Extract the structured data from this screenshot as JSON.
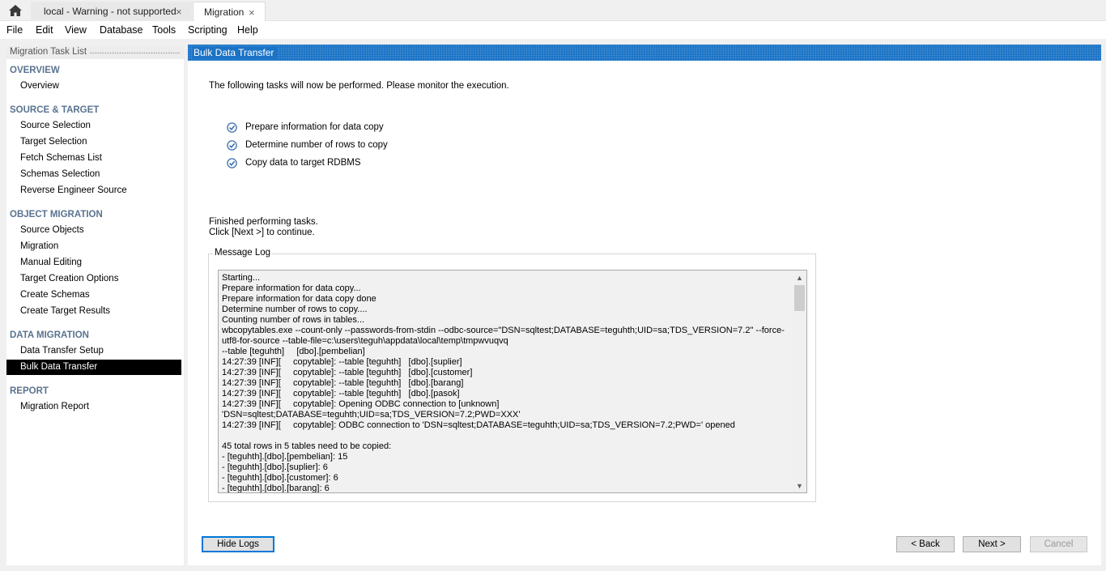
{
  "tabs": [
    {
      "label": "local - Warning - not supported",
      "close": "×"
    },
    {
      "label": "Migration",
      "close": "×"
    }
  ],
  "menu": [
    "File",
    "Edit",
    "View",
    "Database",
    "Tools",
    "Scripting",
    "Help"
  ],
  "sidebar": {
    "title": "Migration Task List",
    "sections": [
      {
        "title": "OVERVIEW",
        "items": [
          "Overview"
        ]
      },
      {
        "title": "SOURCE & TARGET",
        "items": [
          "Source Selection",
          "Target Selection",
          "Fetch Schemas List",
          "Schemas Selection",
          "Reverse Engineer Source"
        ]
      },
      {
        "title": "OBJECT MIGRATION",
        "items": [
          "Source Objects",
          "Migration",
          "Manual Editing",
          "Target Creation Options",
          "Create Schemas",
          "Create Target Results"
        ]
      },
      {
        "title": "DATA MIGRATION",
        "items": [
          "Data Transfer Setup",
          "Bulk Data Transfer"
        ]
      },
      {
        "title": "REPORT",
        "items": [
          "Migration Report"
        ]
      }
    ],
    "selected": "Bulk Data Transfer"
  },
  "main": {
    "title": "Bulk Data Transfer",
    "intro": "The following tasks will now be performed. Please monitor the execution.",
    "tasks": [
      {
        "label": "Prepare information for data copy",
        "checked": true
      },
      {
        "label": "Determine number of rows to copy",
        "checked": true
      },
      {
        "label": "Copy data to target RDBMS",
        "checked": true
      }
    ],
    "status_line1": "Finished performing tasks.",
    "status_line2": "Click [Next >] to continue.",
    "message_log": {
      "legend": "Message Log",
      "lines": [
        "Starting...",
        "Prepare information for data copy...",
        "Prepare information for data copy done",
        "Determine number of rows to copy....",
        "Counting number of rows in tables...",
        "wbcopytables.exe --count-only --passwords-from-stdin --odbc-source=\"DSN=sqltest;DATABASE=teguhth;UID=sa;TDS_VERSION=7.2\" --force-",
        "utf8-for-source --table-file=c:\\users\\teguh\\appdata\\local\\temp\\tmpwvuqvq",
        "--table [teguhth]     [dbo].[pembelian]",
        "14:27:39 [INF][     copytable]: --table [teguhth]   [dbo].[suplier]",
        "14:27:39 [INF][     copytable]: --table [teguhth]   [dbo].[customer]",
        "14:27:39 [INF][     copytable]: --table [teguhth]   [dbo].[barang]",
        "14:27:39 [INF][     copytable]: --table [teguhth]   [dbo].[pasok]",
        "14:27:39 [INF][     copytable]: Opening ODBC connection to [unknown]",
        "'DSN=sqltest;DATABASE=teguhth;UID=sa;TDS_VERSION=7.2;PWD=XXX'",
        "14:27:39 [INF][     copytable]: ODBC connection to 'DSN=sqltest;DATABASE=teguhth;UID=sa;TDS_VERSION=7.2;PWD=' opened",
        "",
        "45 total rows in 5 tables need to be copied:",
        "- [teguhth].[dbo].[pembelian]: 15",
        "- [teguhth].[dbo].[suplier]: 6",
        "- [teguhth].[dbo].[customer]: 6",
        "- [teguhth].[dbo].[barang]: 6"
      ]
    }
  },
  "buttons": {
    "hide_logs": "Hide Logs",
    "back": "< Back",
    "next": "Next >",
    "cancel": "Cancel"
  },
  "colors": {
    "header_blue": "#1a73c6",
    "section_title": "#5a7390",
    "check_blue": "#3c6fb0",
    "focus_border": "#0078d7"
  }
}
